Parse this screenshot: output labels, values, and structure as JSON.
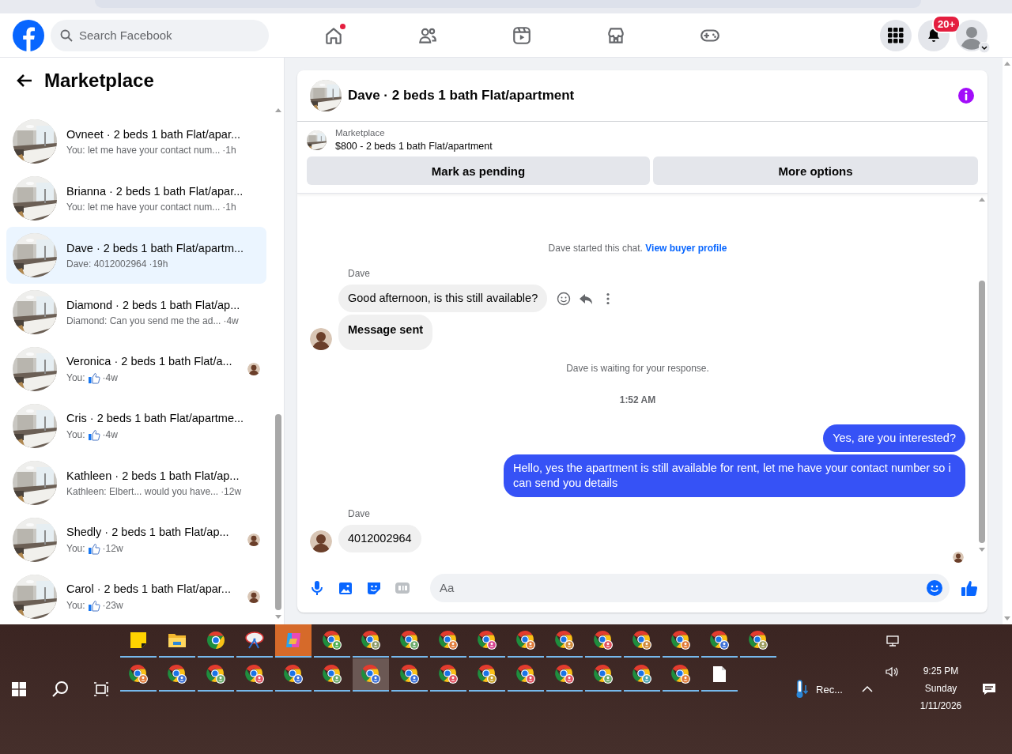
{
  "header": {
    "search": {
      "placeholder": "Search Facebook"
    },
    "nav": [
      {
        "kind": "home",
        "dot": true
      },
      {
        "kind": "friends",
        "dot": false
      },
      {
        "kind": "video",
        "dot": false
      },
      {
        "kind": "marketplace",
        "dot": false
      },
      {
        "kind": "gaming",
        "dot": false
      }
    ],
    "notifications_badge": "20+"
  },
  "sidebar": {
    "title": "Marketplace",
    "conversations": [
      {
        "title": "Ovneet · 2 beds 1 bath Flat/apar...",
        "preview": "You: let me have your contact num...",
        "like": false,
        "time": "·1h",
        "selected": false,
        "seen": false
      },
      {
        "title": "Brianna · 2 beds 1 bath Flat/apar...",
        "preview": "You: let me have your contact num...",
        "like": false,
        "time": "·1h",
        "selected": false,
        "seen": false
      },
      {
        "title": "Dave · 2 beds 1 bath Flat/apartm...",
        "preview": "Dave: 4012002964",
        "like": false,
        "time": "·19h",
        "selected": true,
        "seen": false
      },
      {
        "title": "Diamond · 2 beds 1 bath Flat/ap...",
        "preview": "Diamond: Can you send me the ad...",
        "like": false,
        "time": "·4w",
        "selected": false,
        "seen": false
      },
      {
        "title": "Veronica · 2 beds 1 bath Flat/a...",
        "preview": "You:",
        "like": true,
        "time": "·4w",
        "selected": false,
        "seen": true
      },
      {
        "title": "Cris · 2 beds 1 bath Flat/apartme...",
        "preview": "You:",
        "like": true,
        "time": "·4w",
        "selected": false,
        "seen": false
      },
      {
        "title": "Kathleen · 2 beds 1 bath Flat/ap...",
        "preview": "Kathleen: Elbert... would you have...",
        "like": false,
        "time": "·12w",
        "selected": false,
        "seen": false
      },
      {
        "title": "Shedly · 2 beds 1 bath Flat/ap...",
        "preview": "You:",
        "like": true,
        "time": "·12w",
        "selected": false,
        "seen": true
      },
      {
        "title": "Carol · 2 beds 1 bath Flat/apar...",
        "preview": "You:",
        "like": true,
        "time": "·23w",
        "selected": false,
        "seen": true
      }
    ]
  },
  "chat": {
    "title": "Dave · 2 beds 1 bath Flat/apartment",
    "listing": {
      "source": "Marketplace",
      "name": "$800 - 2 beds 1 bath Flat/apartment"
    },
    "actions": [
      "Mark as pending",
      "More options"
    ],
    "messages": [
      {
        "kind": "notice",
        "text": "Dave started this chat.",
        "link": "View buyer profile"
      },
      {
        "kind": "incoming",
        "sender": "Dave",
        "bubbles": [
          {
            "text": "Good afternoon, is this still available?",
            "bold": false,
            "hover": true
          },
          {
            "text": "Message sent",
            "bold": true,
            "hover": false
          }
        ]
      },
      {
        "kind": "notice",
        "text": "Dave is waiting for your response."
      },
      {
        "kind": "timestamp",
        "text": "1:52 AM"
      },
      {
        "kind": "outgoing",
        "bubbles": [
          {
            "text": "Yes, are you interested?",
            "bold": false
          },
          {
            "text": "Hello, yes the apartment is still available for rent, let me have your contact number so i can send you details",
            "bold": false
          }
        ]
      },
      {
        "kind": "incoming",
        "sender": "Dave",
        "bubbles": [
          {
            "text": "4012002964",
            "bold": false,
            "hover": false
          }
        ]
      }
    ],
    "seen": true,
    "composer": {
      "placeholder": "Aa"
    }
  },
  "taskbar": {
    "weather": "Rec...",
    "time": "9:25 PM",
    "day": "Sunday",
    "date": "1/11/2026"
  }
}
